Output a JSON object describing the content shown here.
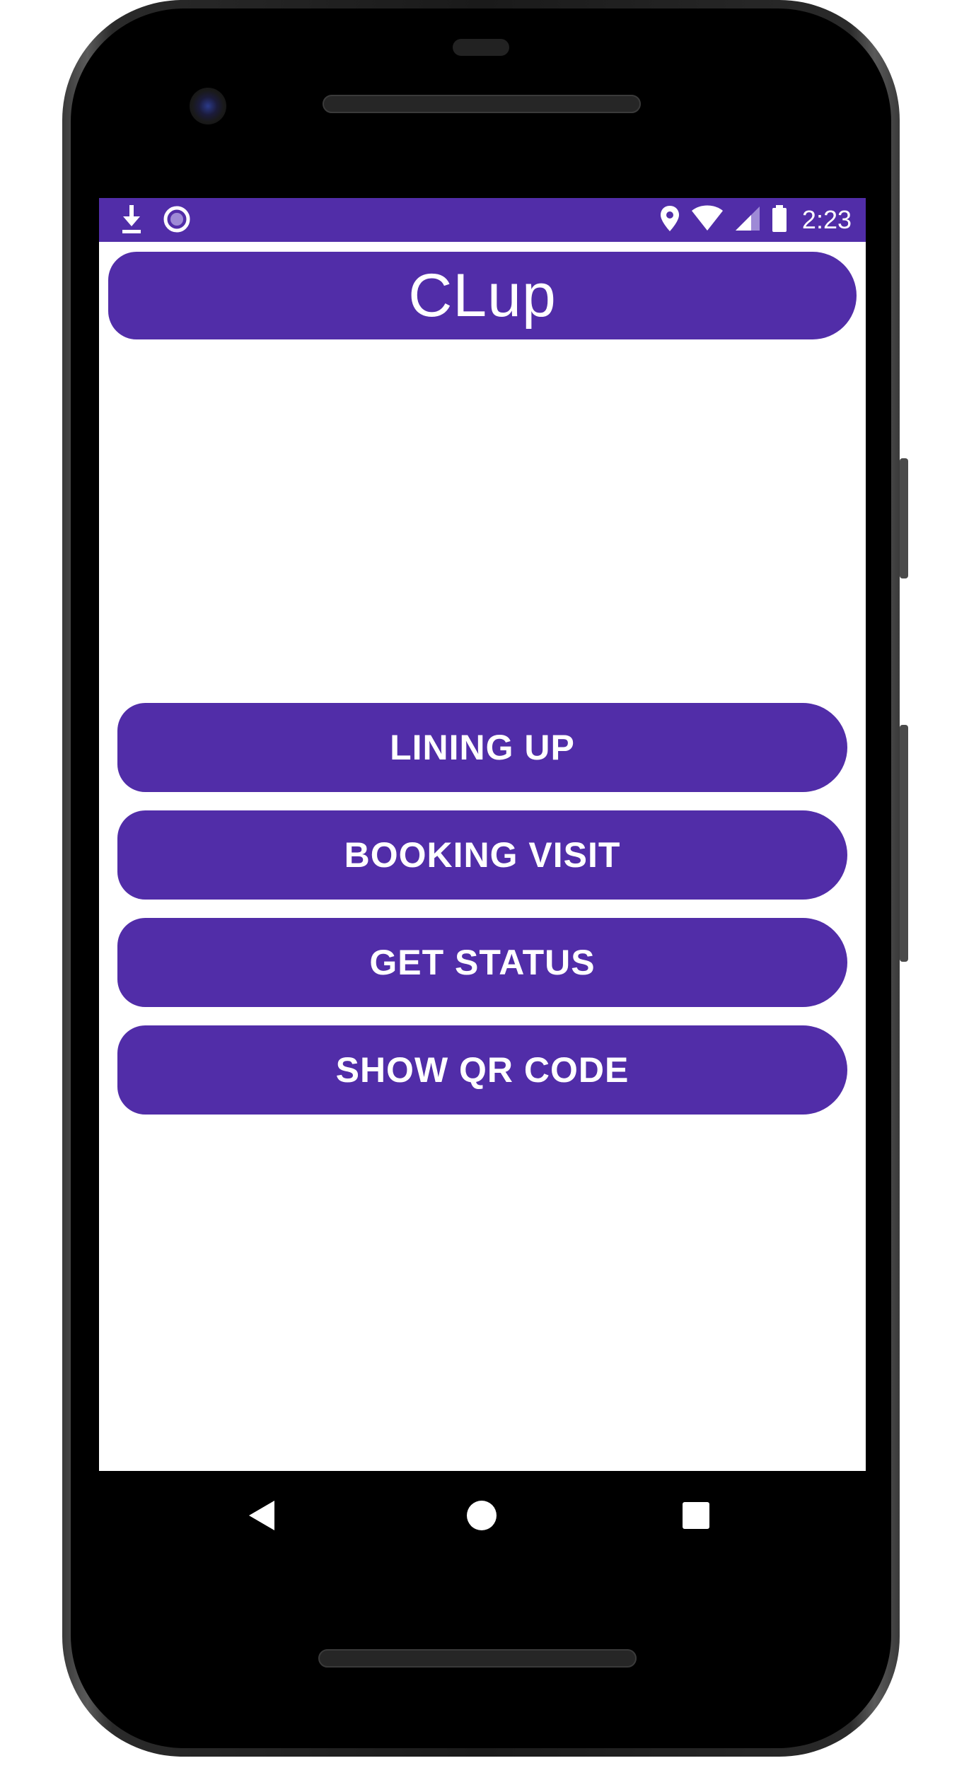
{
  "status_bar": {
    "time": "2:23",
    "left_icons": [
      "download-icon",
      "circle-record-icon"
    ],
    "right_icons": [
      "location-pin-icon",
      "wifi-icon",
      "cell-signal-icon",
      "battery-icon"
    ],
    "color": "#512da8"
  },
  "app": {
    "title": "CLup",
    "accent_color": "#512da8"
  },
  "menu": {
    "lining_up": "LINING UP",
    "booking_visit": "BOOKING VISIT",
    "get_status": "GET STATUS",
    "show_qr_code": "SHOW QR CODE"
  },
  "navigation": {
    "back": "back-icon",
    "home": "home-icon",
    "recents": "recents-icon"
  }
}
